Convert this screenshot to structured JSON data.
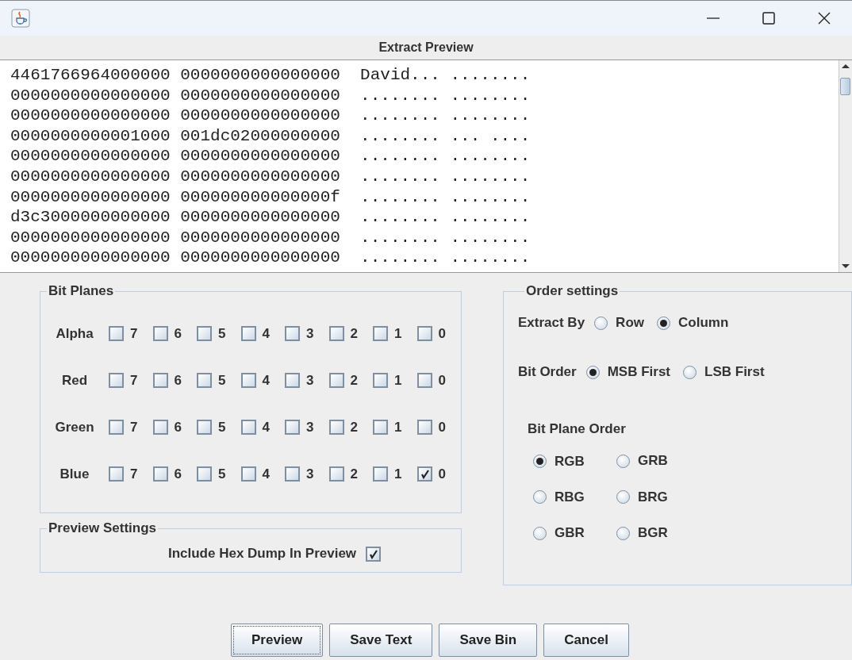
{
  "preview": {
    "title": "Extract Preview",
    "lines": [
      "4461766964000000 0000000000000000  David... ........",
      "0000000000000000 0000000000000000  ........ ........",
      "0000000000000000 0000000000000000  ........ ........",
      "0000000000001000 001dc02000000000  ........ ... ....",
      "0000000000000000 0000000000000000  ........ ........",
      "0000000000000000 0000000000000000  ........ ........",
      "0000000000000000 000000000000000f  ........ ........",
      "d3c3000000000000 0000000000000000  ........ ........",
      "0000000000000000 0000000000000000  ........ ........",
      "0000000000000000 0000000000000000  ........ ........"
    ]
  },
  "bit_planes": {
    "title": "Bit Planes",
    "channels": [
      {
        "name": "Alpha",
        "bits": [
          {
            "label": "7",
            "checked": false
          },
          {
            "label": "6",
            "checked": false
          },
          {
            "label": "5",
            "checked": false
          },
          {
            "label": "4",
            "checked": false
          },
          {
            "label": "3",
            "checked": false
          },
          {
            "label": "2",
            "checked": false
          },
          {
            "label": "1",
            "checked": false
          },
          {
            "label": "0",
            "checked": false
          }
        ]
      },
      {
        "name": "Red",
        "bits": [
          {
            "label": "7",
            "checked": false
          },
          {
            "label": "6",
            "checked": false
          },
          {
            "label": "5",
            "checked": false
          },
          {
            "label": "4",
            "checked": false
          },
          {
            "label": "3",
            "checked": false
          },
          {
            "label": "2",
            "checked": false
          },
          {
            "label": "1",
            "checked": false
          },
          {
            "label": "0",
            "checked": false
          }
        ]
      },
      {
        "name": "Green",
        "bits": [
          {
            "label": "7",
            "checked": false
          },
          {
            "label": "6",
            "checked": false
          },
          {
            "label": "5",
            "checked": false
          },
          {
            "label": "4",
            "checked": false
          },
          {
            "label": "3",
            "checked": false
          },
          {
            "label": "2",
            "checked": false
          },
          {
            "label": "1",
            "checked": false
          },
          {
            "label": "0",
            "checked": false
          }
        ]
      },
      {
        "name": "Blue",
        "bits": [
          {
            "label": "7",
            "checked": false
          },
          {
            "label": "6",
            "checked": false
          },
          {
            "label": "5",
            "checked": false
          },
          {
            "label": "4",
            "checked": false
          },
          {
            "label": "3",
            "checked": false
          },
          {
            "label": "2",
            "checked": false
          },
          {
            "label": "1",
            "checked": false
          },
          {
            "label": "0",
            "checked": true
          }
        ]
      }
    ]
  },
  "preview_settings": {
    "title": "Preview Settings",
    "options": [
      {
        "label": "Include Hex Dump In Preview",
        "checked": true
      }
    ]
  },
  "order_settings": {
    "title": "Order settings",
    "extract_by": {
      "label": "Extract By",
      "options": [
        {
          "label": "Row",
          "selected": false
        },
        {
          "label": "Column",
          "selected": true
        }
      ]
    },
    "bit_order": {
      "label": "Bit Order",
      "options": [
        {
          "label": "MSB First",
          "selected": true
        },
        {
          "label": "LSB First",
          "selected": false
        }
      ]
    },
    "bit_plane_order": {
      "label": "Bit Plane Order",
      "options": [
        {
          "label": "RGB",
          "selected": true
        },
        {
          "label": "GRB",
          "selected": false
        },
        {
          "label": "RBG",
          "selected": false
        },
        {
          "label": "BRG",
          "selected": false
        },
        {
          "label": "GBR",
          "selected": false
        },
        {
          "label": "BGR",
          "selected": false
        }
      ]
    }
  },
  "buttons": [
    {
      "label": "Preview",
      "focused": true
    },
    {
      "label": "Save Text",
      "focused": false
    },
    {
      "label": "Save Bin",
      "focused": false
    },
    {
      "label": "Cancel",
      "focused": false
    }
  ]
}
